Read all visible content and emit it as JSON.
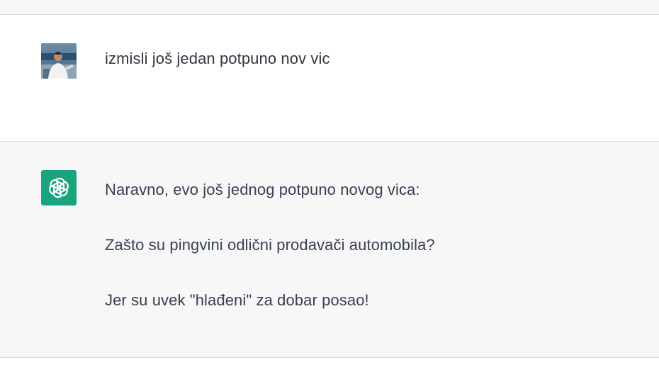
{
  "conversation": {
    "user_message": {
      "avatar_icon": "user-photo-avatar",
      "text": "izmisli još jedan potpuno nov vic"
    },
    "assistant_message": {
      "logo_icon": "openai-logo-icon",
      "logo_color": "#19a37f",
      "paragraphs": [
        "Naravno, evo još jednog potpuno novog vica:",
        "Zašto su pingvini odlični prodavači automobila?",
        "Jer su uvek \"hlađeni\" za dobar posao!"
      ]
    }
  }
}
